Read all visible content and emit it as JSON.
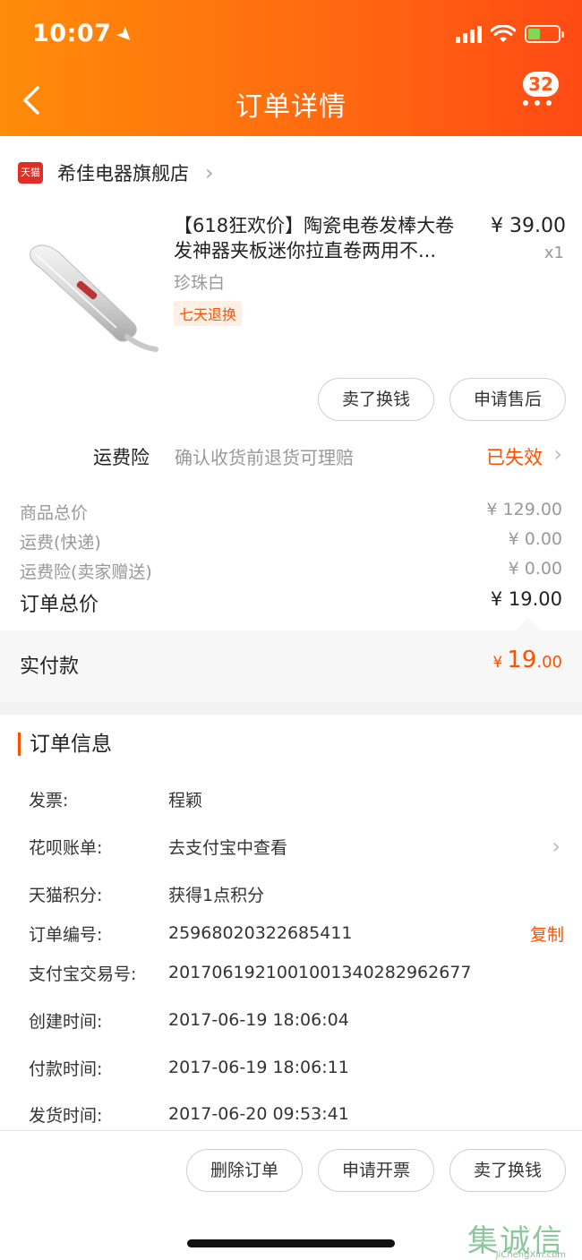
{
  "status_bar": {
    "time": "10:07"
  },
  "header": {
    "title": "订单详情",
    "badge": "32"
  },
  "store": {
    "icon_text": "天猫",
    "name": "希佳电器旗舰店"
  },
  "product": {
    "title_line1": "【618狂欢价】陶瓷电卷发棒大卷",
    "title_line2": "发神器夹板迷你拉直卷两用不...",
    "price": "¥ 39.00",
    "qty": "x1",
    "spec": "珍珠白",
    "tag": "七天退换",
    "btn_sell": "卖了换钱",
    "btn_after_sale": "申请售后"
  },
  "insurance": {
    "label": "运费险",
    "desc": "确认收货前退货可理赔",
    "status": "已失效"
  },
  "summary": {
    "goods_total_label": "商品总价",
    "goods_total": "¥ 129.00",
    "shipping_label": "运费(快递)",
    "shipping": "¥ 0.00",
    "ins_label": "运费险(卖家赠送)",
    "ins": "¥ 0.00",
    "order_total_label": "订单总价",
    "order_total": "¥ 19.00",
    "paid_label": "实付款",
    "paid_cur": "¥",
    "paid_int": "19",
    "paid_dec": ".00"
  },
  "order_info": {
    "title": "订单信息",
    "invoice_label": "发票:",
    "invoice": "程颖",
    "huabei_label": "花呗账单:",
    "huabei": "去支付宝中查看",
    "points_label": "天猫积分:",
    "points": "获得1点积分",
    "order_no_label": "订单编号:",
    "order_no": "25968020322685411",
    "copy": "复制",
    "alipay_label": "支付宝交易号:",
    "alipay_no": "2017061921001001340282962677",
    "created_label": "创建时间:",
    "created": "2017-06-19 18:06:04",
    "paid_label": "付款时间:",
    "paid": "2017-06-19 18:06:11",
    "shipped_label": "发货时间:",
    "shipped": "2017-06-20 09:53:41"
  },
  "bottom_bar": {
    "delete": "删除订单",
    "invoice": "申请开票",
    "sell": "卖了换钱"
  },
  "watermark": {
    "logo": "集诚信",
    "sub": "JiChengXin.com"
  },
  "colors": {
    "accent": "#ff5000",
    "header_start": "#ff8c0a",
    "header_end": "#ff4a14"
  }
}
